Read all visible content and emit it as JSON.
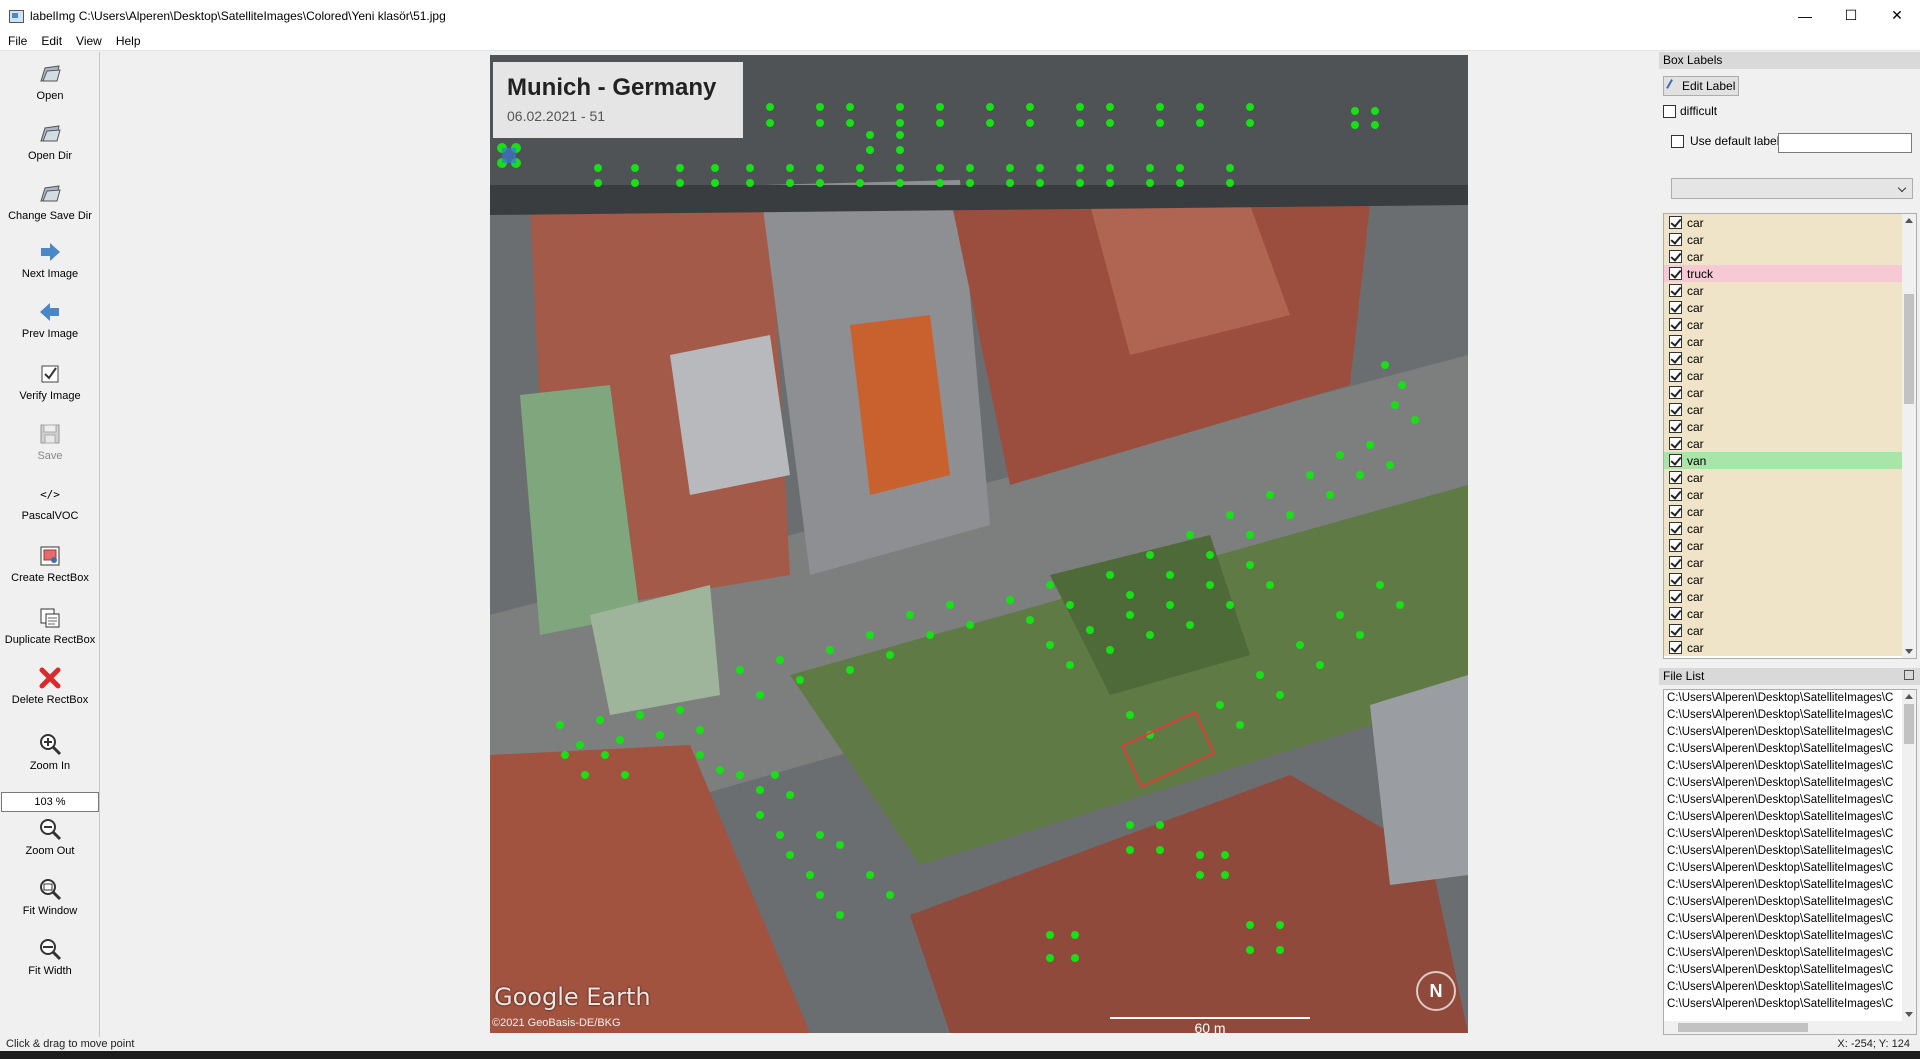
{
  "window": {
    "title": "labelImg C:\\Users\\Alperen\\Desktop\\SatelliteImages\\Colored\\Yeni klasör\\51.jpg",
    "minimize": "—",
    "maximize": "☐",
    "close": "✕"
  },
  "menu": [
    "File",
    "Edit",
    "View",
    "Help"
  ],
  "toolbar": {
    "open": "Open",
    "open_dir": "Open Dir",
    "change_save_dir": "Change Save Dir",
    "next_image": "Next Image",
    "prev_image": "Prev Image",
    "verify_image": "Verify Image",
    "save": "Save",
    "format": "PascalVOC",
    "format_glyph": "</>",
    "create_rectbox": "Create RectBox",
    "duplicate_rectbox": "Duplicate RectBox",
    "delete_rectbox": "Delete RectBox",
    "zoom_in": "Zoom In",
    "zoom_value": "103 %",
    "zoom_out": "Zoom Out",
    "fit_window": "Fit Window",
    "fit_width": "Fit Width"
  },
  "image": {
    "overlay_title": "Munich - Germany",
    "overlay_subtitle": "06.02.2021 - 51",
    "logo": "Google Earth",
    "copyright": "©2021 GeoBasis-DE/BKG",
    "scale": "60 m",
    "north": "N"
  },
  "box_labels": {
    "header": "Box Labels",
    "edit_label": "Edit Label",
    "difficult": "difficult",
    "use_default_label": "Use default label",
    "default_label_value": "",
    "items": [
      "car",
      "car",
      "car",
      "truck",
      "car",
      "car",
      "car",
      "car",
      "car",
      "car",
      "car",
      "car",
      "car",
      "car",
      "van",
      "car",
      "car",
      "car",
      "car",
      "car",
      "car",
      "car",
      "car",
      "car",
      "car",
      "car"
    ],
    "colors": {
      "car": "#f0e4c8",
      "truck": "#f7c9d4",
      "van": "#a9e5a9"
    }
  },
  "file_list": {
    "header": "File List",
    "items": [
      "C:\\Users\\Alperen\\Desktop\\SatelliteImages\\C",
      "C:\\Users\\Alperen\\Desktop\\SatelliteImages\\C",
      "C:\\Users\\Alperen\\Desktop\\SatelliteImages\\C",
      "C:\\Users\\Alperen\\Desktop\\SatelliteImages\\C",
      "C:\\Users\\Alperen\\Desktop\\SatelliteImages\\C",
      "C:\\Users\\Alperen\\Desktop\\SatelliteImages\\C",
      "C:\\Users\\Alperen\\Desktop\\SatelliteImages\\C",
      "C:\\Users\\Alperen\\Desktop\\SatelliteImages\\C",
      "C:\\Users\\Alperen\\Desktop\\SatelliteImages\\C",
      "C:\\Users\\Alperen\\Desktop\\SatelliteImages\\C",
      "C:\\Users\\Alperen\\Desktop\\SatelliteImages\\C",
      "C:\\Users\\Alperen\\Desktop\\SatelliteImages\\C",
      "C:\\Users\\Alperen\\Desktop\\SatelliteImages\\C",
      "C:\\Users\\Alperen\\Desktop\\SatelliteImages\\C",
      "C:\\Users\\Alperen\\Desktop\\SatelliteImages\\C",
      "C:\\Users\\Alperen\\Desktop\\SatelliteImages\\C",
      "C:\\Users\\Alperen\\Desktop\\SatelliteImages\\C",
      "C:\\Users\\Alperen\\Desktop\\SatelliteImages\\C",
      "C:\\Users\\Alperen\\Desktop\\SatelliteImages\\C"
    ]
  },
  "status": {
    "message": "Click & drag to move point",
    "coords": "X: -254; Y: 124"
  }
}
